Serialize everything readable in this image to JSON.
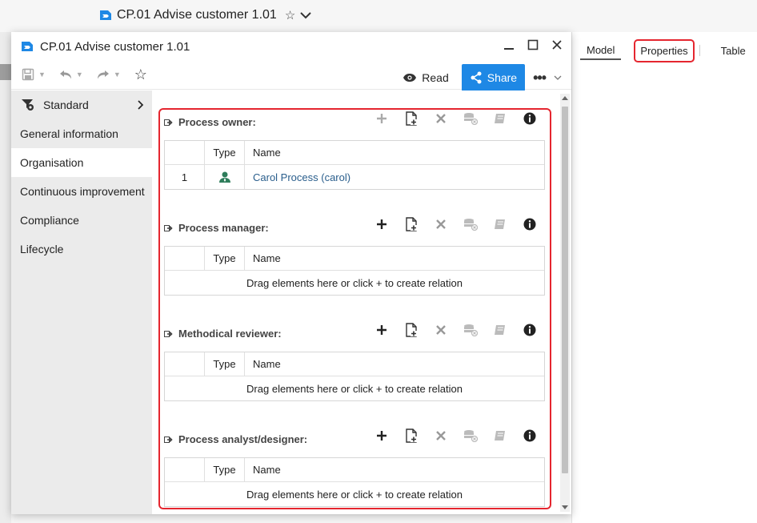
{
  "app": {
    "doc_title": "CP.01 Advise customer 1.01"
  },
  "right_tabs": {
    "model": "Model",
    "properties": "Properties",
    "table": "Table"
  },
  "dialog": {
    "title": "CP.01 Advise customer 1.01",
    "toolbar": {
      "read_label": "Read",
      "share_label": "Share"
    }
  },
  "sidebar": {
    "header": "Standard",
    "items": [
      {
        "label": "General information"
      },
      {
        "label": "Organisation"
      },
      {
        "label": "Continuous improvement"
      },
      {
        "label": "Compliance"
      },
      {
        "label": "Lifecycle"
      }
    ]
  },
  "sections": [
    {
      "title": "Process owner:",
      "col_type": "Type",
      "col_name": "Name",
      "rows": [
        {
          "num": "1",
          "name": "Carol Process (carol)"
        }
      ]
    },
    {
      "title": "Process manager:",
      "col_type": "Type",
      "col_name": "Name",
      "empty": "Drag elements here or click + to create relation"
    },
    {
      "title": "Methodical reviewer:",
      "col_type": "Type",
      "col_name": "Name",
      "empty": "Drag elements here or click + to create relation"
    },
    {
      "title": "Process analyst/designer:",
      "col_type": "Type",
      "col_name": "Name",
      "empty": "Drag elements here or click + to create relation"
    }
  ],
  "colors": {
    "accent": "#1e88e5",
    "highlight": "#e5262f",
    "link": "#2a5e8c",
    "user_icon": "#2e7d5b"
  }
}
